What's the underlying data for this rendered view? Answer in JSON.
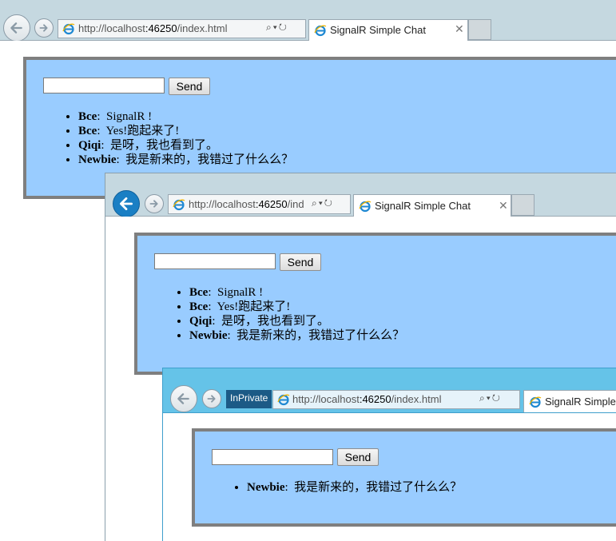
{
  "windows": [
    {
      "address": {
        "url_prefix": "http://localhost",
        "url_port": ":46250",
        "url_path": "/index.html"
      },
      "tab": {
        "title": "SignalR Simple Chat"
      },
      "chat": {
        "send_label": "Send",
        "input_value": "",
        "messages": [
          {
            "name": "Bce",
            "sep": ":",
            "text": "SignalR !"
          },
          {
            "name": "Bce",
            "sep": ":",
            "text": "Yes!跑起来了!"
          },
          {
            "name": "Qiqi",
            "sep": ":",
            "text": "是呀，我也看到了。"
          },
          {
            "name": "Newbie",
            "sep": ":",
            "text": "我是新来的，我错过了什么么？"
          }
        ]
      }
    },
    {
      "address": {
        "url_prefix": "http://localhost",
        "url_port": ":46250",
        "url_path": "/ind"
      },
      "tab": {
        "title": "SignalR Simple Chat"
      },
      "chat": {
        "send_label": "Send",
        "input_value": "",
        "messages": [
          {
            "name": "Bce",
            "sep": ":",
            "text": "SignalR !"
          },
          {
            "name": "Bce",
            "sep": ":",
            "text": "Yes!跑起来了!"
          },
          {
            "name": "Qiqi",
            "sep": ":",
            "text": "是呀，我也看到了。"
          },
          {
            "name": "Newbie",
            "sep": ":",
            "text": "我是新来的，我错过了什么么？"
          }
        ]
      }
    },
    {
      "inprivate_label": "InPrivate",
      "address": {
        "url_prefix": "http://localhost",
        "url_port": ":46250",
        "url_path": "/index.html"
      },
      "tab": {
        "title": "SignalR Simple C"
      },
      "chat": {
        "send_label": "Send",
        "input_value": "",
        "messages": [
          {
            "name": "Newbie",
            "sep": ":",
            "text": "我是新来的，我错过了什么么？"
          }
        ]
      }
    }
  ],
  "colors": {
    "chat_background": "#99ccff",
    "chat_border": "#7f7f7f",
    "frame_default": "#c5d8e0",
    "frame_inprivate": "#65c3e8",
    "back_active": "#1a7fc4"
  },
  "icons": {
    "back": "back-arrow-icon",
    "forward": "forward-arrow-icon",
    "favicon": "ie-logo-icon",
    "search": "search-icon",
    "refresh": "refresh-icon",
    "close": "close-icon"
  }
}
